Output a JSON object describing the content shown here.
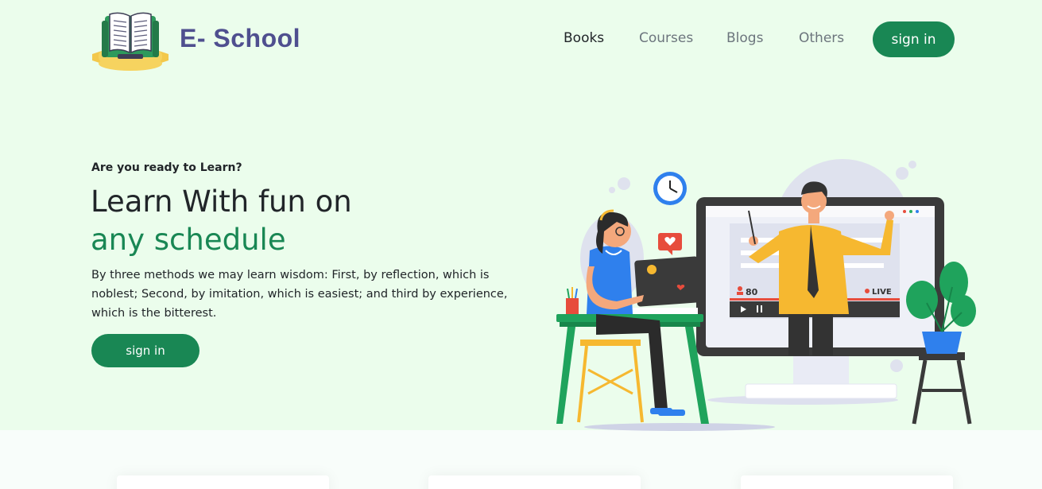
{
  "brand": {
    "name": "E- School",
    "logo_icon": "open-book-logo"
  },
  "nav": {
    "links": [
      {
        "label": "Books",
        "active": true
      },
      {
        "label": "Courses",
        "active": false
      },
      {
        "label": "Blogs",
        "active": false
      },
      {
        "label": "Others",
        "active": false
      }
    ],
    "signin_label": "sign in"
  },
  "hero": {
    "kicker": "Are you ready to Learn?",
    "headline_line1": "Learn With fun on",
    "headline_line2": "any schedule",
    "description": "By three methods we may learn wisdom: First, by reflection, which is noblest; Second, by imitation, which is easiest; and third by experience, which is the bitterest.",
    "cta_label": "sign in",
    "illustration": {
      "viewer_count": "80",
      "live_label": "LIVE"
    }
  },
  "colors": {
    "accent": "#198754",
    "brand_text": "#4f4f8f",
    "hero_bg": "#ebfdec"
  }
}
